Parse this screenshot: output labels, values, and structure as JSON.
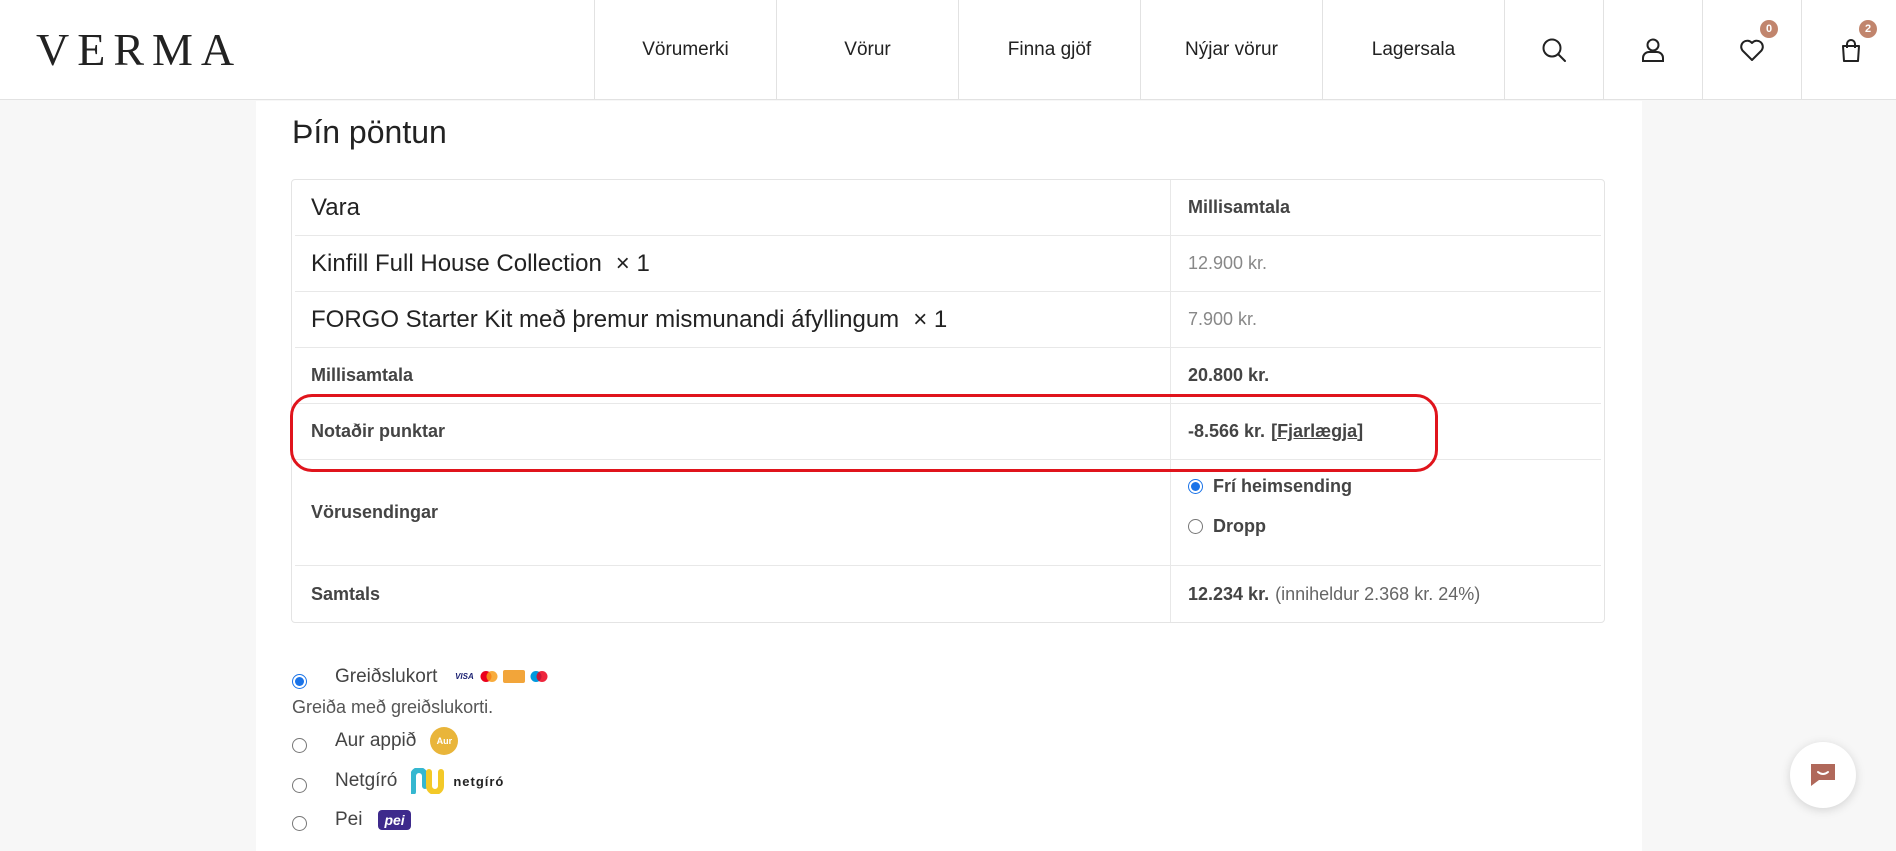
{
  "header": {
    "logo": "VERMA",
    "nav": [
      "Vörumerki",
      "Vörur",
      "Finna gjöf",
      "Nýjar vörur",
      "Lagersala"
    ],
    "wishlist_count": "0",
    "cart_count": "2"
  },
  "order": {
    "title": "Þín pöntun",
    "col_product": "Vara",
    "col_subtotal": "Millisamtala",
    "items": [
      {
        "name": "Kinfill Full House Collection",
        "qty": "× 1",
        "price": "12.900 kr."
      },
      {
        "name": "FORGO Starter Kit með þremur mismunandi áfyllingum",
        "qty": "× 1",
        "price": "7.900 kr."
      }
    ],
    "subtotal_label": "Millisamtala",
    "subtotal_value": "20.800 kr.",
    "points_label": "Notaðir punktar",
    "points_value": "-8.566 kr.",
    "points_bracket_open": "[",
    "points_remove": "Fjarlægja",
    "points_bracket_close": "]",
    "shipping_label": "Vörusendingar",
    "shipping_options": [
      {
        "label": "Frí heimsending",
        "selected": true
      },
      {
        "label": "Dropp",
        "selected": false
      }
    ],
    "total_label": "Samtals",
    "total_value": "12.234 kr.",
    "total_tax": "(inniheldur 2.368 kr. 24%)"
  },
  "payment": {
    "options": [
      {
        "label": "Greiðslukort",
        "selected": true
      },
      {
        "label": "Aur appið",
        "selected": false
      },
      {
        "label": "Netgíró",
        "selected": false
      },
      {
        "label": "Pei",
        "selected": false
      }
    ],
    "card_description": "Greiða með greiðslukorti.",
    "aur_logo_text": "Aur",
    "netgiro_logo_text": "netgíró",
    "pei_logo_text": "pei",
    "visa_text": "VISA"
  },
  "colors": {
    "highlight": "#e0141c",
    "badge": "#c1856d",
    "accent": "#1a73e8"
  }
}
